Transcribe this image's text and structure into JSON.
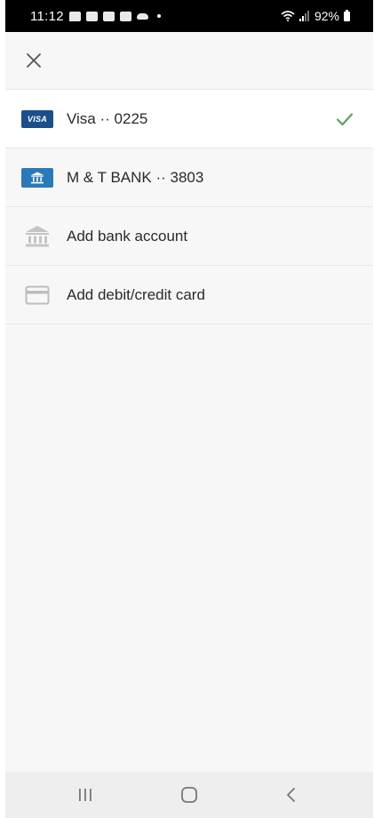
{
  "status_bar": {
    "time": "11:12",
    "battery_percent": "92%",
    "icons": [
      "message-icon",
      "ring-icon",
      "ring-icon",
      "edit-icon",
      "cloud-icon",
      "notification-dot"
    ],
    "right_icons": [
      "wifi-icon",
      "signal-icon",
      "battery-icon"
    ]
  },
  "toolbar": {
    "close_icon": "close-icon"
  },
  "payment_methods": [
    {
      "label": "Visa ·· 0225",
      "icon": "visa-card-icon",
      "badge_text": "VISA",
      "selected": true
    },
    {
      "label": "M & T BANK ·· 3803",
      "icon": "bank-icon",
      "selected": false
    }
  ],
  "add_options": [
    {
      "label": "Add bank account",
      "icon": "bank-outline-icon"
    },
    {
      "label": "Add debit/credit card",
      "icon": "credit-card-outline-icon"
    }
  ],
  "colors": {
    "visa_badge": "#1a4f8b",
    "bank_badge": "#2b79b8",
    "check": "#5aa35a",
    "outline_icon": "#b8b8b8"
  },
  "nav_bar": {
    "buttons": [
      "recent-apps-icon",
      "home-icon",
      "back-icon"
    ]
  }
}
